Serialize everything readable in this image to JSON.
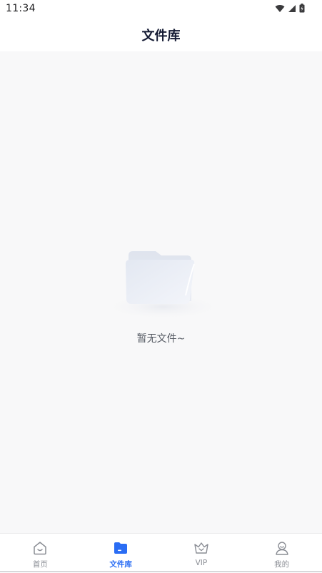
{
  "status_bar": {
    "time": "11:34"
  },
  "header": {
    "title": "文件库"
  },
  "empty_state": {
    "message": "暂无文件~"
  },
  "tab_bar": {
    "active": "文件库",
    "accent_color": "#2a6df4",
    "tabs": [
      {
        "label": "首页",
        "icon": "home-icon"
      },
      {
        "label": "文件库",
        "icon": "folder-icon"
      },
      {
        "label": "VIP",
        "icon": "crown-icon"
      },
      {
        "label": "我的",
        "icon": "person-icon"
      }
    ]
  }
}
